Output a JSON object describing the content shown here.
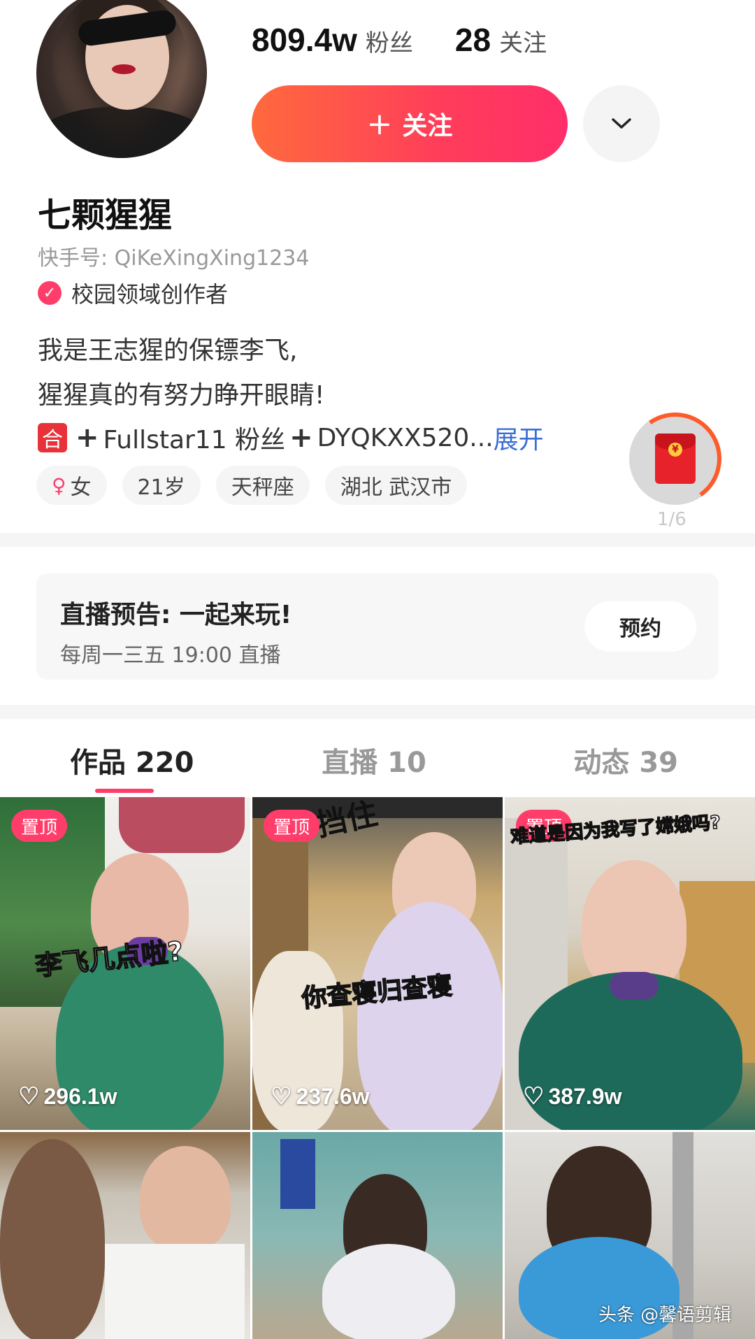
{
  "profile": {
    "fans_count": "809.4w",
    "fans_label": "粉丝",
    "following_count": "28",
    "following_label": "关注",
    "follow_button": "关注",
    "name": "七颗猩猩",
    "uid": "快手号: QiKeXingXing1234",
    "creator_badge": "校园领域创作者",
    "bio_line1": "我是王志猩的保镖李飞,",
    "bio_line2": "猩猩真的有努力睁开眼睛!",
    "bio_line3_tag": "合",
    "bio_line3_a": "Fullstar11 粉丝",
    "bio_line3_b": "DYQKXX520...",
    "bio_expand": "展开",
    "tags": [
      {
        "label": "女"
      },
      {
        "label": "21岁"
      },
      {
        "label": "天秤座"
      },
      {
        "label": "湖北 武汉市"
      }
    ],
    "redpack_count": "1/6"
  },
  "live": {
    "title": "直播预告: 一起来玩!",
    "schedule": "每周一三五 19:00 直播",
    "reserve": "预约"
  },
  "tabs": [
    {
      "label": "作品 220",
      "active": true
    },
    {
      "label": "直播 10",
      "active": false
    },
    {
      "label": "动态 39",
      "active": false
    }
  ],
  "videos": [
    {
      "pinned": "置顶",
      "caption": "李飞几点啦?",
      "likes": "296.1w"
    },
    {
      "pinned": "置顶",
      "caption": "你查寝归查寝",
      "top_text": "挡住",
      "likes": "237.6w"
    },
    {
      "pinned": "置顶",
      "caption": "难道是因为我写了嫦娥吗?",
      "likes": "387.9w"
    },
    {},
    {},
    {}
  ],
  "watermark": "头条 @馨语剪辑",
  "colors": {
    "accent": "#ff3d6a",
    "follow_gradient_start": "#ff6a3d",
    "follow_gradient_end": "#ff2e6a",
    "link": "#3b6fd6"
  }
}
